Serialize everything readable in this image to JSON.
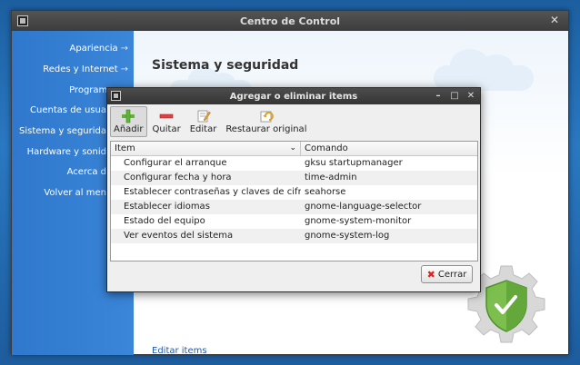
{
  "main_window": {
    "title": "Centro de Control",
    "sidebar": [
      {
        "label": "Apariencia",
        "arrow": "→"
      },
      {
        "label": "Redes y Internet",
        "arrow": "→"
      },
      {
        "label": "Programas",
        "arrow": "→"
      },
      {
        "label": "Cuentas de usua",
        "arrow": ""
      },
      {
        "label": "Sistema y segurida",
        "arrow": ""
      },
      {
        "label": "Hardware y sonid",
        "arrow": ""
      },
      {
        "label": "Acerca d",
        "arrow": ""
      },
      {
        "label": "Volver al men",
        "arrow": ""
      }
    ],
    "page_title": "Sistema y seguridad",
    "edit_link": "Editar items"
  },
  "dialog": {
    "title": "Agregar o eliminar items",
    "toolbar": [
      {
        "label": "Añadir",
        "icon": "add-icon"
      },
      {
        "label": "Quitar",
        "icon": "remove-icon"
      },
      {
        "label": "Editar",
        "icon": "edit-icon"
      },
      {
        "label": "Restaurar original",
        "icon": "restore-icon"
      }
    ],
    "columns": {
      "item": "Item",
      "command": "Comando"
    },
    "rows": [
      {
        "item": "Configurar el arranque",
        "command": "gksu startupmanager"
      },
      {
        "item": "Configurar fecha y hora",
        "command": "time-admin"
      },
      {
        "item": "Establecer contraseñas y claves de cifrado",
        "command": "seahorse"
      },
      {
        "item": "Establecer idiomas",
        "command": "gnome-language-selector"
      },
      {
        "item": "Estado del equipo",
        "command": "gnome-system-monitor"
      },
      {
        "item": "Ver eventos del sistema",
        "command": "gnome-system-log"
      }
    ],
    "close_label": "Cerrar"
  },
  "colors": {
    "sidebar": "#3580d4",
    "titlebar": "#454545",
    "link": "#1f5aa8",
    "accent_green": "#6ab04c"
  }
}
